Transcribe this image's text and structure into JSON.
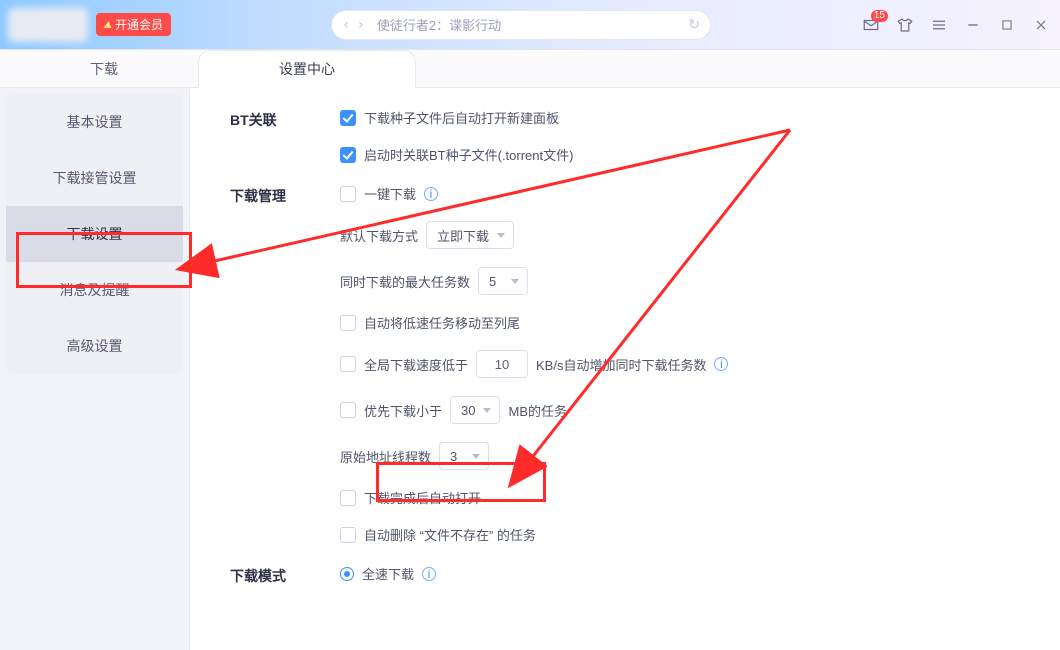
{
  "titlebar": {
    "vip_label": "开通会员",
    "search_placeholder": "使徒行者2：谍影行动",
    "badge_count": "15"
  },
  "tabs": {
    "download": "下载",
    "settings": "设置中心"
  },
  "sidebar": {
    "items": [
      "基本设置",
      "下载接管设置",
      "下载设置",
      "消息及提醒",
      "高级设置"
    ]
  },
  "sections": {
    "bt": {
      "title": "BT关联",
      "auto_open_panel": "下载种子文件后自动打开新建面板",
      "associate_torrent": "启动时关联BT种子文件(.torrent文件)"
    },
    "dlmgr": {
      "title": "下载管理",
      "one_click": "一键下载",
      "default_method_label": "默认下载方式",
      "default_method_value": "立即下载",
      "max_tasks_label": "同时下载的最大任务数",
      "max_tasks_value": "5",
      "move_slow": "自动将低速任务移动至列尾",
      "global_speed_prefix": "全局下载速度低于",
      "global_speed_value": "10",
      "global_speed_suffix": "KB/s自动增加同时下载任务数",
      "prefer_small_prefix": "优先下载小于",
      "prefer_small_value": "30",
      "prefer_small_suffix": "MB的任务",
      "origin_threads_label": "原始地址线程数",
      "origin_threads_value": "3",
      "open_after": "下载完成后自动打开",
      "auto_delete_missing": "自动删除 “文件不存在” 的任务"
    },
    "dlmode": {
      "title": "下载模式",
      "full_speed": "全速下载"
    }
  }
}
